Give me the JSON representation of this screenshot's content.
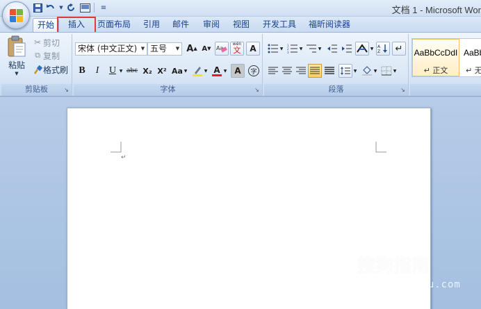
{
  "window": {
    "title": "文档 1 - Microsoft Wor"
  },
  "qat": {
    "items": [
      "save-icon",
      "undo-icon",
      "dropdown-icon",
      "redo-icon",
      "print-preview-icon",
      "customize-icon"
    ]
  },
  "tabs": [
    {
      "label": "开始",
      "active": true
    },
    {
      "label": "插入",
      "highlighted": true
    },
    {
      "label": "页面布局"
    },
    {
      "label": "引用"
    },
    {
      "label": "邮件"
    },
    {
      "label": "审阅"
    },
    {
      "label": "视图"
    },
    {
      "label": "开发工具"
    },
    {
      "label": "福昕阅读器"
    }
  ],
  "clipboard": {
    "title": "剪贴板",
    "paste": "粘贴",
    "cut": "剪切",
    "copy": "复制",
    "format_painter": "格式刷"
  },
  "font": {
    "title": "字体",
    "name": "宋体 (中文正文)",
    "size": "五号",
    "grow": "A",
    "shrink": "A",
    "phonetic": "wén",
    "bold": "B",
    "italic": "I",
    "underline": "U",
    "strike": "abc",
    "subscript": "X₂",
    "superscript": "X²",
    "case": "Aa",
    "color_letter": "A",
    "shade_letter": "A",
    "enclose": "字"
  },
  "paragraph": {
    "title": "段落"
  },
  "styles": {
    "items": [
      {
        "sample": "AaBbCcDdI",
        "name": "↵ 正文"
      },
      {
        "sample": "AaBbC",
        "name": "↵ 无"
      }
    ]
  },
  "colors": {
    "ribbon_bg": "#dde9f7",
    "tab_text": "#15428b",
    "highlight": "#e23a3a",
    "font_color": "#e0201f",
    "highlighter": "#f7e02a"
  },
  "watermark": {
    "brand": "搜狗指南",
    "url": "zhinan.sogou.com"
  }
}
